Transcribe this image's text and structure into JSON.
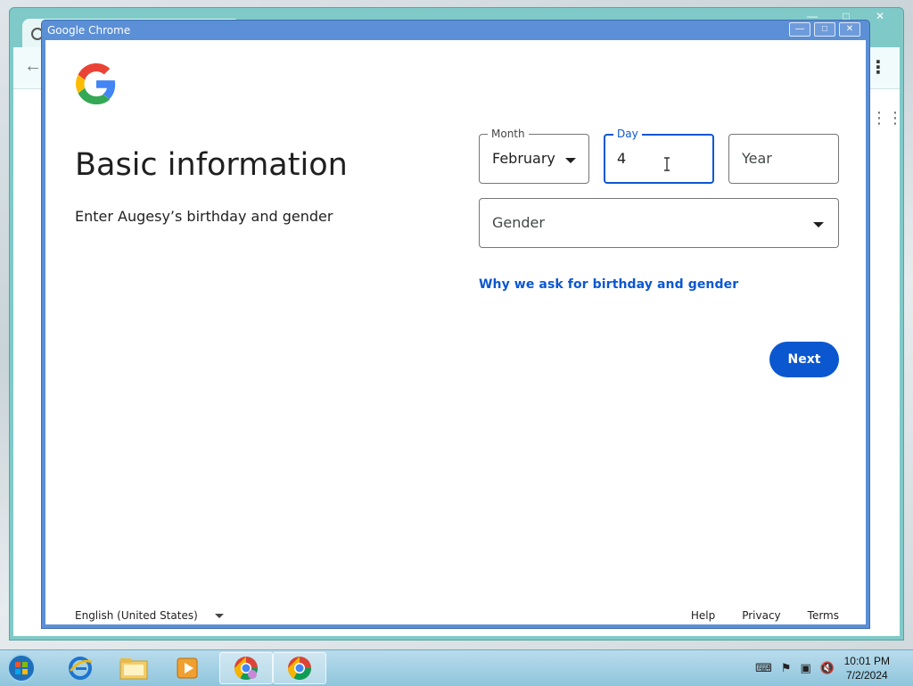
{
  "popup": {
    "title": "Google Chrome"
  },
  "page": {
    "heading": "Basic information",
    "subtext": "Enter Augesy’s birthday and gender"
  },
  "form": {
    "month": {
      "label": "Month",
      "value": "February"
    },
    "day": {
      "label": "Day",
      "value": "4"
    },
    "year": {
      "placeholder": "Year"
    },
    "gender": {
      "placeholder": "Gender"
    },
    "why_link": "Why we ask for birthday and gender",
    "next_label": "Next"
  },
  "footer": {
    "language": "English (United States)",
    "links": [
      "Help",
      "Privacy",
      "Terms"
    ]
  },
  "taskbar": {
    "time": "10:01 PM",
    "date": "7/2/2024"
  },
  "colors": {
    "accent": "#0b57d0",
    "popup_titlebar": "#5b8fd6",
    "background_chrome": "#7fcac8"
  }
}
